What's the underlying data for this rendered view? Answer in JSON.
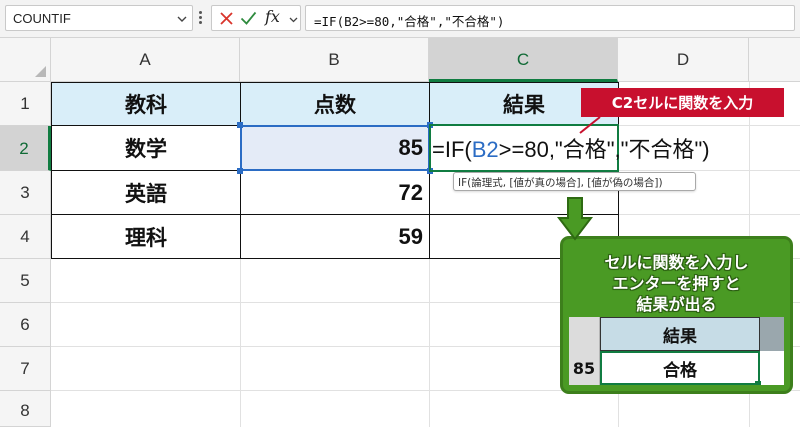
{
  "formula_bar": {
    "name_box": "COUNTIF",
    "fx_label": "fx",
    "formula": "=IF(B2>=80,\"合格\",\"不合格\")"
  },
  "columns": [
    "A",
    "B",
    "C",
    "D"
  ],
  "rows": [
    "1",
    "2",
    "3",
    "4",
    "5",
    "6",
    "7",
    "8"
  ],
  "table": {
    "headers": [
      "教科",
      "点数",
      "結果"
    ],
    "data": [
      {
        "subject": "数学",
        "score": "85"
      },
      {
        "subject": "英語",
        "score": "72"
      },
      {
        "subject": "理科",
        "score": "59"
      }
    ]
  },
  "editing": {
    "formula_prefix": "=IF(",
    "formula_ref": "B2",
    "formula_suffix": ">=80,\"合格\",\"不合格\")",
    "tooltip": "IF(論理式, [値が真の場合], [値が偽の場合])"
  },
  "callout": {
    "text": "C2セルに関数を入力"
  },
  "panel": {
    "lines": [
      "セルに関数を入力し",
      "エンターを押すと",
      "結果が出る"
    ],
    "header": "結果",
    "score": "85",
    "result": "合格"
  },
  "colors": {
    "accent_green": "#107c41",
    "header_fill": "#d9eef9",
    "callout_red": "#c8102e",
    "panel_green": "#4a9a24",
    "ref_blue": "#2b6cc4"
  },
  "icons": [
    "chevron-down-icon",
    "more-options-icon",
    "cancel-icon",
    "enter-icon",
    "fx-icon",
    "select-all-icon",
    "down-arrow-icon"
  ]
}
